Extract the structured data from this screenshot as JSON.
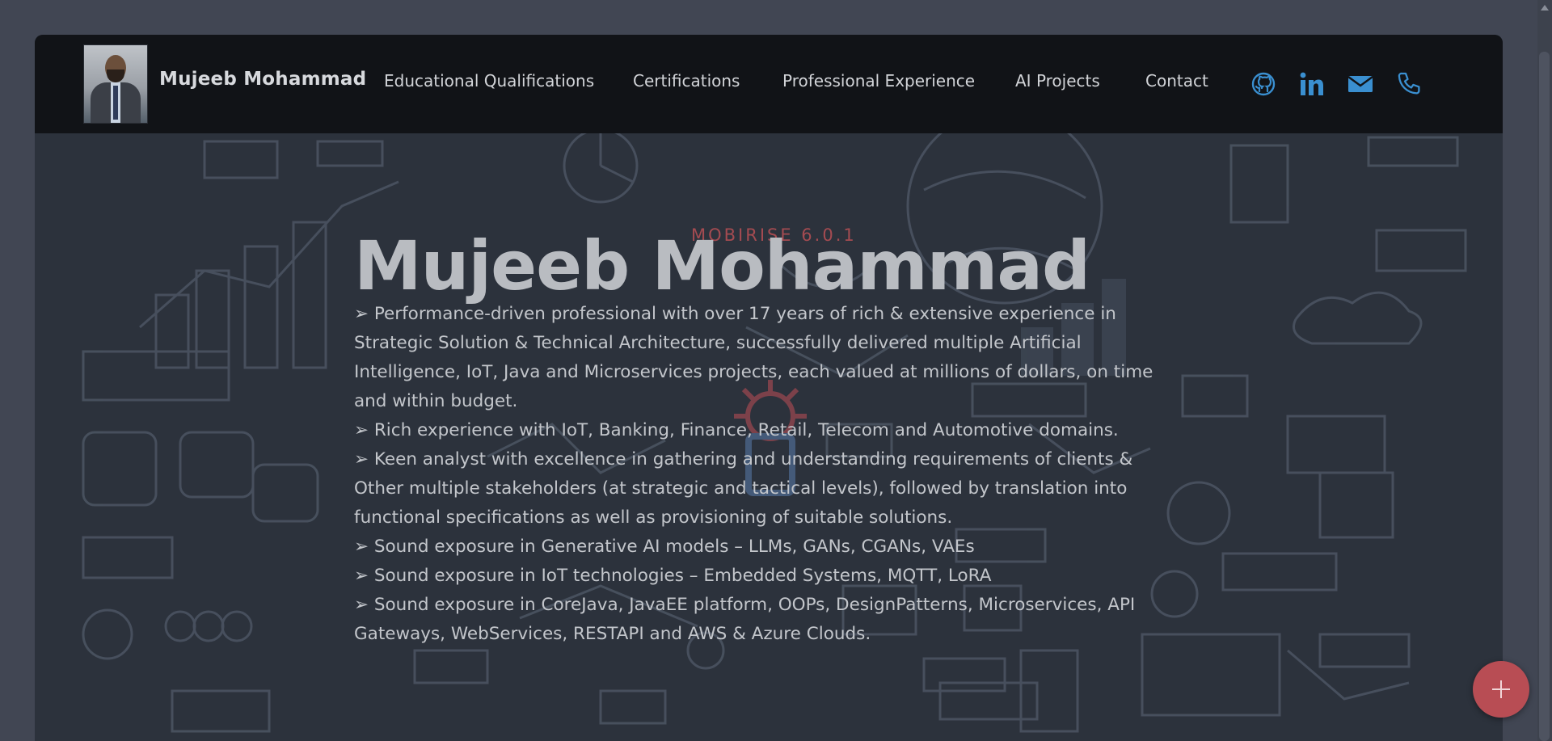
{
  "brand": {
    "name": "Mujeeb Mohammad",
    "avatar_alt": "profile photo"
  },
  "nav": {
    "items": [
      {
        "label": "Educational Qualifications"
      },
      {
        "label": "Certifications"
      },
      {
        "label": "Professional Experience"
      },
      {
        "label": "AI Projects"
      },
      {
        "label": "Contact"
      }
    ],
    "social": [
      {
        "icon": "github-icon"
      },
      {
        "icon": "linkedin-icon"
      },
      {
        "icon": "mail-icon"
      },
      {
        "icon": "phone-icon"
      }
    ]
  },
  "hero": {
    "watermark": "MOBIRISE 6.0.1",
    "title": "Mujeeb Mohammad",
    "bio": [
      "➢ Performance-driven professional with over 17 years of rich & extensive experience in Strategic Solution & Technical Architecture, successfully delivered multiple Artificial Intelligence, IoT, Java and Microservices projects, each valued at millions of dollars, on time and within budget.",
      "➢ Rich experience with IoT, Banking, Finance, Retail, Telecom and Automotive domains.",
      "➢ Keen analyst with excellence in gathering and understanding requirements of clients & Other multiple stakeholders (at strategic and tactical levels), followed by translation into functional specifications as well as provisioning of suitable solutions.",
      "➢ Sound exposure in Generative AI models – LLMs, GANs, CGANs, VAEs",
      "➢ Sound exposure in IoT technologies – Embedded Systems, MQTT, LoRA",
      "➢ Sound exposure in CoreJava, JavaEE platform, OOPs, DesignPatterns, Microservices, API Gateways, WebServices, RESTAPI and AWS & Azure Clouds."
    ]
  },
  "colors": {
    "navbar": "#111317",
    "accent": "#3a8fd0",
    "fab": "#b84d54",
    "watermark": "#a44b51"
  }
}
